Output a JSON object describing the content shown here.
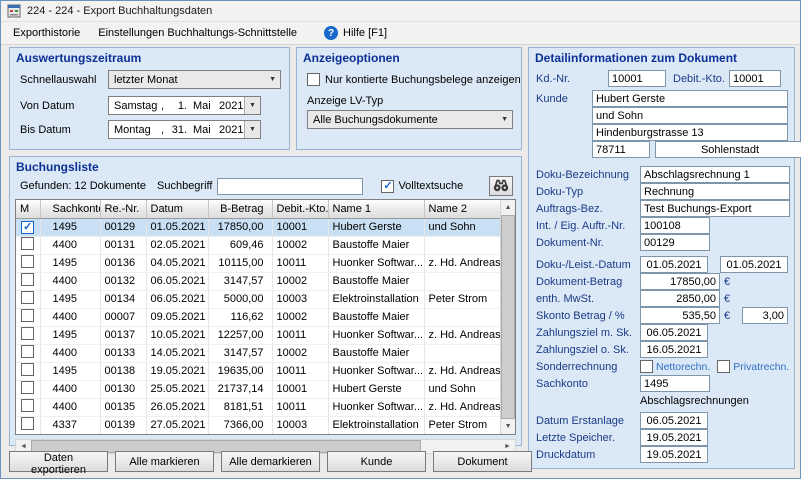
{
  "window": {
    "title": "224 - 224 - Export Buchhaltungsdaten"
  },
  "menubar": {
    "items": [
      {
        "label": "Exporthistorie"
      },
      {
        "label": "Einstellungen Buchhaltungs-Schnittstelle"
      }
    ],
    "help_icon": "?",
    "help_label": "Hilfe  [F1]"
  },
  "colors": {
    "group_title": "#0c3094",
    "selection": "#c9dff4",
    "help_badge": "#1869c8",
    "label_blue": "#1b3a86"
  },
  "zeitraum": {
    "title": "Auswertungszeitraum",
    "schnellauswahl_label": "Schnellauswahl",
    "schnellauswahl_value": "letzter Monat",
    "von": {
      "label": "Von Datum",
      "day": "Samstag",
      "sep": ",",
      "num": "1.",
      "month": "Mai",
      "year": "2021"
    },
    "bis": {
      "label": "Bis Datum",
      "day": "Montag",
      "sep": ",",
      "num": "31.",
      "month": "Mai",
      "year": "2021"
    }
  },
  "anzeige": {
    "title": "Anzeigeoptionen",
    "nur_kontierte_label": "Nur kontierte Buchungsbelege anzeigen",
    "nur_kontierte_checked": false,
    "lv_typ_label": "Anzeige LV-Typ",
    "lv_typ_value": "Alle Buchungsdokumente"
  },
  "buchungsliste": {
    "title": "Buchungsliste",
    "gefunden_text": "Gefunden: 12 Dokumente",
    "suchbegriff_label": "Suchbegriff",
    "suchbegriff_value": "",
    "volltextsuche_label": "Volltextsuche",
    "volltextsuche_checked": true,
    "columns": [
      "M",
      "Sachkonto",
      "Re.-Nr.",
      "Datum",
      "B-Betrag",
      "Debit.-Kto.",
      "Name 1",
      "Name 2"
    ],
    "rows": [
      {
        "checked": true,
        "selected": true,
        "cells": [
          "1495",
          "00129",
          "01.05.2021",
          "17850,00",
          "10001",
          "Hubert Gerste",
          "und Sohn"
        ]
      },
      {
        "checked": false,
        "selected": false,
        "cells": [
          "4400",
          "00131",
          "02.05.2021",
          "609,46",
          "10002",
          "Baustoffe Maier",
          ""
        ]
      },
      {
        "checked": false,
        "selected": false,
        "cells": [
          "1495",
          "00136",
          "04.05.2021",
          "10115,00",
          "10011",
          "Huonker Softwar...",
          "z. Hd. Andreas ..."
        ]
      },
      {
        "checked": false,
        "selected": false,
        "cells": [
          "4400",
          "00132",
          "06.05.2021",
          "3147,57",
          "10002",
          "Baustoffe Maier",
          ""
        ]
      },
      {
        "checked": false,
        "selected": false,
        "cells": [
          "1495",
          "00134",
          "06.05.2021",
          "5000,00",
          "10003",
          "Elektroinstallation",
          "Peter Strom"
        ]
      },
      {
        "checked": false,
        "selected": false,
        "cells": [
          "4400",
          "00007",
          "09.05.2021",
          "116,62",
          "10002",
          "Baustoffe Maier",
          ""
        ]
      },
      {
        "checked": false,
        "selected": false,
        "cells": [
          "1495",
          "00137",
          "10.05.2021",
          "12257,00",
          "10011",
          "Huonker Softwar...",
          "z. Hd. Andreas ..."
        ]
      },
      {
        "checked": false,
        "selected": false,
        "cells": [
          "4400",
          "00133",
          "14.05.2021",
          "3147,57",
          "10002",
          "Baustoffe Maier",
          ""
        ]
      },
      {
        "checked": false,
        "selected": false,
        "cells": [
          "1495",
          "00138",
          "19.05.2021",
          "19635,00",
          "10011",
          "Huonker Softwar...",
          "z. Hd. Andreas ..."
        ]
      },
      {
        "checked": false,
        "selected": false,
        "cells": [
          "4400",
          "00130",
          "25.05.2021",
          "21737,14",
          "10001",
          "Hubert Gerste",
          "und Sohn"
        ]
      },
      {
        "checked": false,
        "selected": false,
        "cells": [
          "4400",
          "00135",
          "26.05.2021",
          "8181,51",
          "10011",
          "Huonker Softwar...",
          "z. Hd. Andreas ..."
        ]
      },
      {
        "checked": false,
        "selected": false,
        "cells": [
          "4337",
          "00139",
          "27.05.2021",
          "7366,00",
          "10003",
          "Elektroinstallation",
          "Peter Strom"
        ]
      }
    ]
  },
  "footer_buttons": [
    "Daten exportieren",
    "Alle markieren",
    "Alle demarkieren",
    "Kunde",
    "Dokument"
  ],
  "detail": {
    "title": "Detailinformationen zum Dokument",
    "kd_nr_label": "Kd.-Nr.",
    "kd_nr": "10001",
    "debit_kto_label": "Debit.-Kto.",
    "debit_kto": "10001",
    "kunde_label": "Kunde",
    "kunde_name1": "Hubert Gerste",
    "kunde_name2": "und Sohn",
    "strasse": "Hindenburgstrasse 13",
    "plz": "78711",
    "ort": "Sohlenstadt",
    "doku_bez_label": "Doku-Bezeichnung",
    "doku_bez": "Abschlagsrechnung 1",
    "doku_typ_label": "Doku-Typ",
    "doku_typ": "Rechnung",
    "auftrags_bez_label": "Auftrags-Bez.",
    "auftrags_bez": "Test Buchungs-Export",
    "int_auftr_label": "Int. / Eig. Auftr.-Nr.",
    "int_auftr": "100108",
    "dokument_nr_label": "Dokument-Nr.",
    "dokument_nr": "00129",
    "doku_leist_label": "Doku-/Leist.-Datum",
    "doku_datum": "01.05.2021",
    "leist_datum": "01.05.2021",
    "betrag_label": "Dokument-Betrag",
    "betrag": "17850,00",
    "euro": "€",
    "mwst_label": "enth. MwSt.",
    "mwst": "2850,00",
    "skonto_label": "Skonto Betrag / %",
    "skonto_betrag": "535,50",
    "skonto_prozent": "3,00",
    "zziel_m_label": "Zahlungsziel m. Sk.",
    "zziel_m": "06.05.2021",
    "zziel_o_label": "Zahlungsziel o. Sk.",
    "zziel_o": "16.05.2021",
    "sonder_label": "Sonderrechnung",
    "netto_label": "Nettorechn.",
    "netto_checked": false,
    "privat_label": "Privatrechn.",
    "privat_checked": false,
    "sachkonto_label": "Sachkonto",
    "sachkonto": "1495",
    "sachkonto_name": "Abschlagsrechnungen",
    "erstanlage_label": "Datum Erstanlage",
    "erstanlage": "06.05.2021",
    "speicher_label": "Letzte Speicher.",
    "speicher": "19.05.2021",
    "druck_label": "Druckdatum",
    "druck": "19.05.2021"
  }
}
